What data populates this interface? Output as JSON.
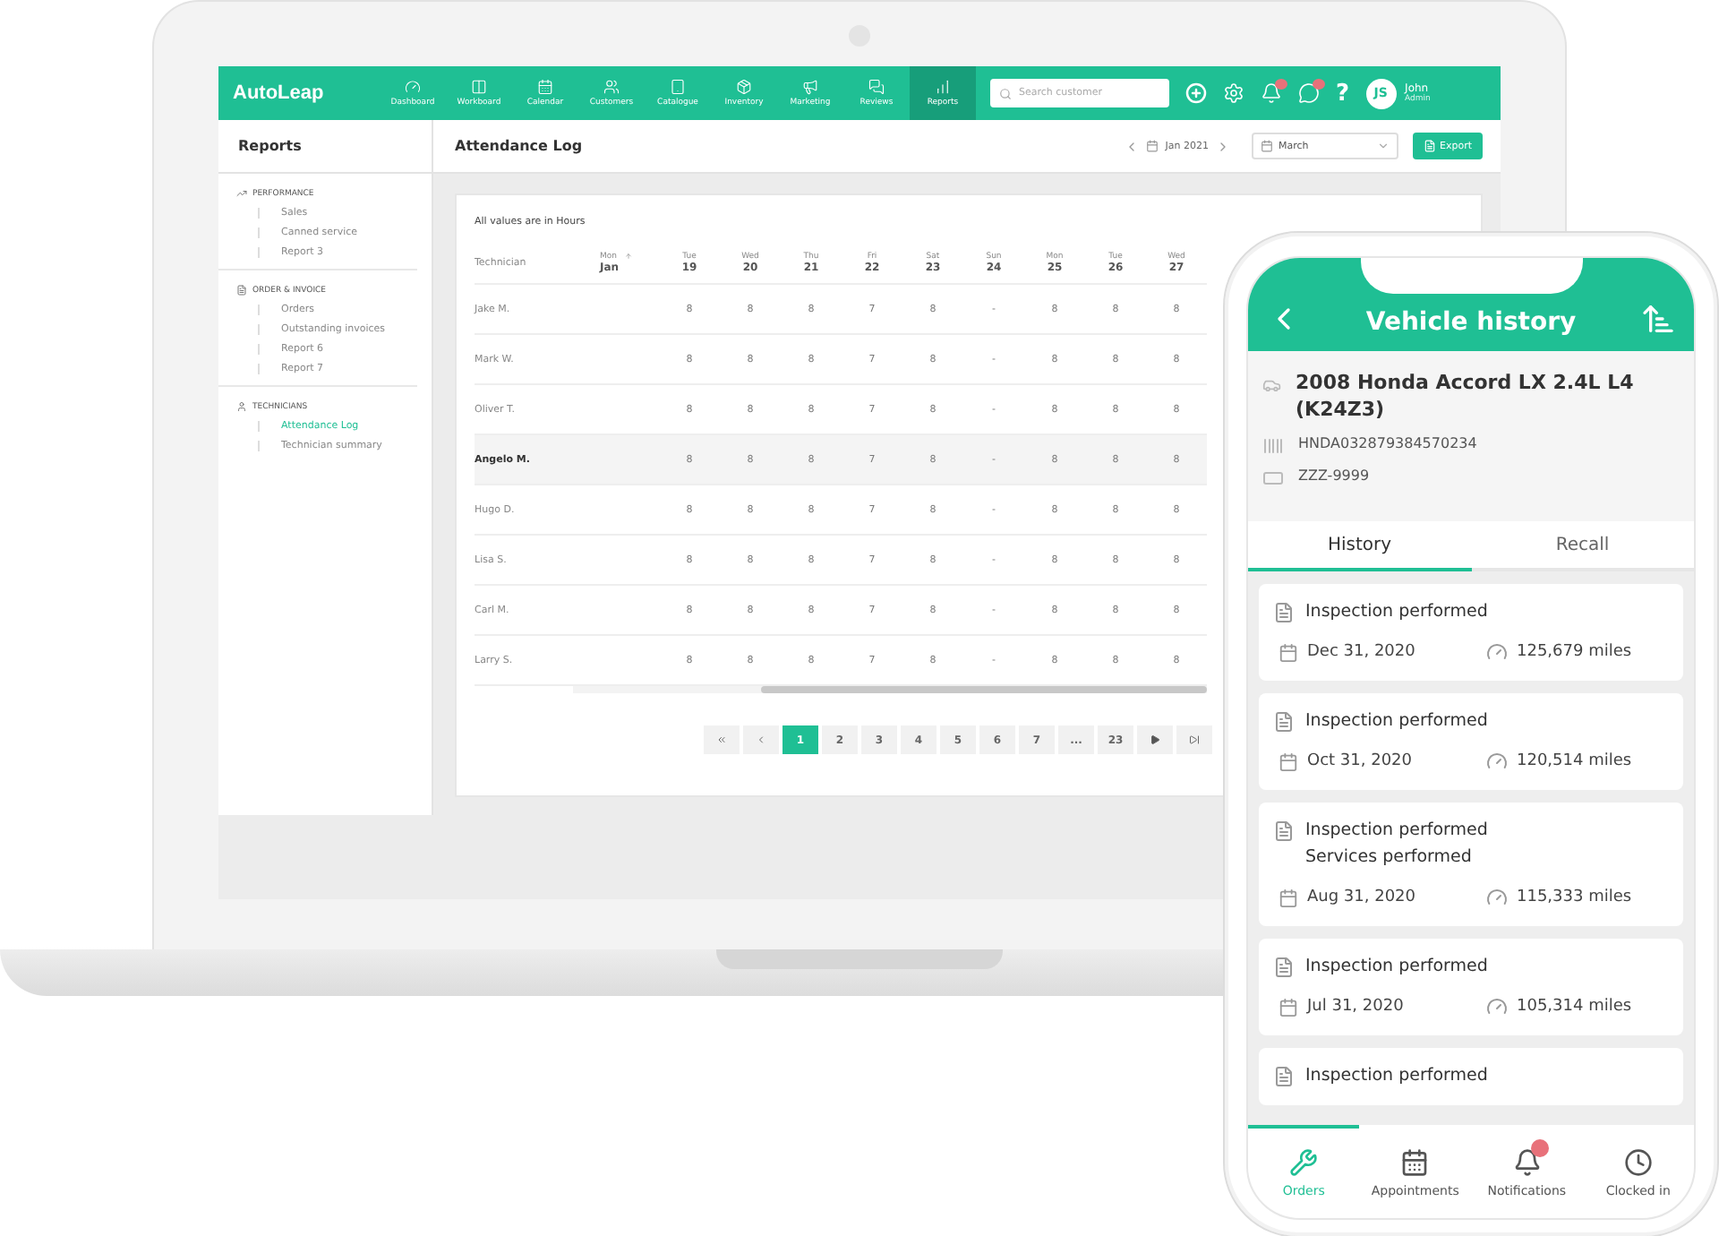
{
  "app": {
    "logo": "AutoLeap",
    "nav": [
      {
        "kind": "dashboard",
        "label": "Dashboard",
        "selected": false
      },
      {
        "kind": "workboard",
        "label": "Workboard",
        "selected": false
      },
      {
        "kind": "calendar",
        "label": "Calendar",
        "selected": false
      },
      {
        "kind": "customers",
        "label": "Customers",
        "selected": false
      },
      {
        "kind": "catalogue",
        "label": "Catalogue",
        "selected": false
      },
      {
        "kind": "inventory",
        "label": "Inventory",
        "selected": false
      },
      {
        "kind": "marketing",
        "label": "Marketing",
        "selected": false
      },
      {
        "kind": "reviews",
        "label": "Reviews",
        "selected": false
      },
      {
        "kind": "reports",
        "label": "Reports",
        "selected": true
      }
    ],
    "search": {
      "placeholder": "Search customer"
    },
    "header_icons": [
      {
        "kind": "add"
      },
      {
        "kind": "settings"
      },
      {
        "kind": "notifications",
        "alert": true
      },
      {
        "kind": "messages",
        "alert": true
      }
    ],
    "help": "?",
    "user": {
      "initials": "JS",
      "name": "John",
      "role": "Admin"
    }
  },
  "sidebar": {
    "title": "Reports",
    "groups": [
      {
        "kind": "performance",
        "title": "PERFORMANCE",
        "items": [
          {
            "label": "Sales",
            "selected": false
          },
          {
            "label": "Canned service",
            "selected": false
          },
          {
            "label": "Report 3",
            "selected": false
          }
        ]
      },
      {
        "kind": "orders",
        "title": "ORDER & INVOICE",
        "items": [
          {
            "label": "Orders",
            "selected": false
          },
          {
            "label": "Outstanding invoices",
            "selected": false
          },
          {
            "label": "Report 6",
            "selected": false
          },
          {
            "label": "Report 7",
            "selected": false
          }
        ]
      },
      {
        "kind": "technicians",
        "title": "TECHNICIANS",
        "items": [
          {
            "label": "Attendance Log",
            "selected": true
          },
          {
            "label": "Technician summary",
            "selected": false
          }
        ]
      }
    ]
  },
  "page": {
    "title": "Attendance Log",
    "period": "Jan 2021",
    "month_select": "March",
    "export_button": "Export"
  },
  "table": {
    "note": "All values are in Hours",
    "first_column": "Technician",
    "week_column": {
      "weekday": "Mon",
      "month": "Jan"
    },
    "day_columns": [
      {
        "weekday": "Tue",
        "day": "19"
      },
      {
        "weekday": "Wed",
        "day": "20"
      },
      {
        "weekday": "Thu",
        "day": "21"
      },
      {
        "weekday": "Fri",
        "day": "22"
      },
      {
        "weekday": "Sat",
        "day": "23"
      },
      {
        "weekday": "Sun",
        "day": "24"
      },
      {
        "weekday": "Mon",
        "day": "25"
      },
      {
        "weekday": "Tue",
        "day": "26"
      },
      {
        "weekday": "Wed",
        "day": "27"
      }
    ],
    "rows": [
      {
        "name": "Jake M.",
        "selected": false,
        "values": [
          "8",
          "8",
          "8",
          "7",
          "8",
          "-",
          "8",
          "8",
          "8"
        ]
      },
      {
        "name": "Mark W.",
        "selected": false,
        "values": [
          "8",
          "8",
          "8",
          "7",
          "8",
          "-",
          "8",
          "8",
          "8"
        ]
      },
      {
        "name": "Oliver T.",
        "selected": false,
        "values": [
          "8",
          "8",
          "8",
          "7",
          "8",
          "-",
          "8",
          "8",
          "8"
        ]
      },
      {
        "name": "Angelo M.",
        "selected": true,
        "values": [
          "8",
          "8",
          "8",
          "7",
          "8",
          "-",
          "8",
          "8",
          "8"
        ]
      },
      {
        "name": "Hugo D.",
        "selected": false,
        "values": [
          "8",
          "8",
          "8",
          "7",
          "8",
          "-",
          "8",
          "8",
          "8"
        ]
      },
      {
        "name": "Lisa S.",
        "selected": false,
        "values": [
          "8",
          "8",
          "8",
          "7",
          "8",
          "-",
          "8",
          "8",
          "8"
        ]
      },
      {
        "name": "Carl M.",
        "selected": false,
        "values": [
          "8",
          "8",
          "8",
          "7",
          "8",
          "-",
          "8",
          "8",
          "8"
        ]
      },
      {
        "name": "Larry S.",
        "selected": false,
        "values": [
          "8",
          "8",
          "8",
          "7",
          "8",
          "-",
          "8",
          "8",
          "8"
        ]
      }
    ]
  },
  "pagination": [
    {
      "kind": "first"
    },
    {
      "kind": "prev"
    },
    {
      "kind": "page",
      "label": "1",
      "selected": true
    },
    {
      "kind": "page",
      "label": "2",
      "selected": false
    },
    {
      "kind": "page",
      "label": "3",
      "selected": false
    },
    {
      "kind": "page",
      "label": "4",
      "selected": false
    },
    {
      "kind": "page",
      "label": "5",
      "selected": false
    },
    {
      "kind": "page",
      "label": "6",
      "selected": false
    },
    {
      "kind": "page",
      "label": "7",
      "selected": false
    },
    {
      "kind": "page",
      "label": "...",
      "selected": false
    },
    {
      "kind": "page",
      "label": "23",
      "selected": false
    },
    {
      "kind": "next"
    },
    {
      "kind": "last"
    }
  ],
  "phone": {
    "title": "Vehicle history",
    "vehicle": {
      "name": "2008 Honda Accord LX 2.4L L4 (K24Z3)",
      "vin": "HNDA032879384570234",
      "plate": "ZZZ-9999"
    },
    "tabs": [
      {
        "label": "History",
        "selected": true
      },
      {
        "label": "Recall",
        "selected": false
      }
    ],
    "records": [
      {
        "lines": [
          "Inspection performed"
        ],
        "date": "Dec 31, 2020",
        "mileage": "125,679 miles"
      },
      {
        "lines": [
          "Inspection performed"
        ],
        "date": "Oct 31, 2020",
        "mileage": "120,514 miles"
      },
      {
        "lines": [
          "Inspection performed",
          "Services performed"
        ],
        "date": "Aug 31, 2020",
        "mileage": "115,333 miles"
      },
      {
        "lines": [
          "Inspection performed"
        ],
        "date": "Jul 31, 2020",
        "mileage": "105,314 miles"
      },
      {
        "lines": [
          "Inspection performed"
        ]
      }
    ],
    "bottom_nav": [
      {
        "kind": "orders",
        "label": "Orders",
        "selected": true,
        "alert": false
      },
      {
        "kind": "appointments",
        "label": "Appointments",
        "selected": false,
        "alert": false
      },
      {
        "kind": "notifications",
        "label": "Notifications",
        "selected": false,
        "alert": true
      },
      {
        "kind": "clock",
        "label": "Clocked in",
        "selected": false,
        "alert": false
      }
    ]
  }
}
